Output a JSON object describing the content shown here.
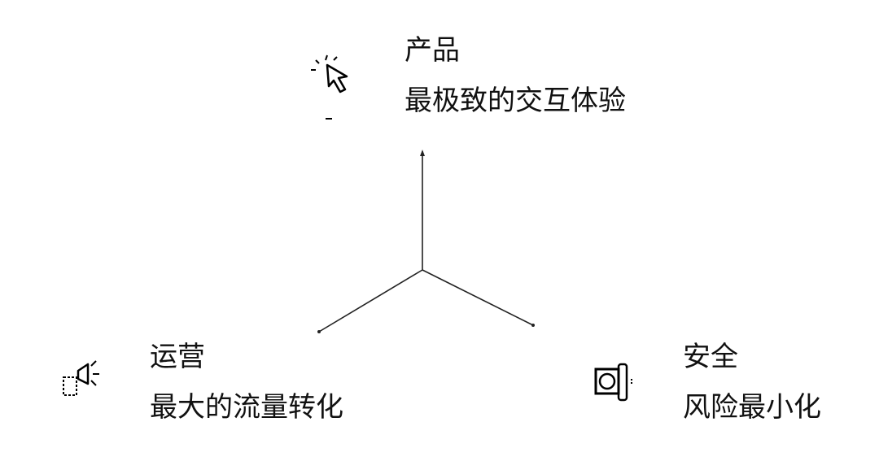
{
  "nodes": {
    "product": {
      "title": "产品",
      "desc": "最极致的交互体验",
      "icon": "cursor-click-icon"
    },
    "operation": {
      "title": "运营",
      "desc": "最大的流量转化",
      "icon": "megaphone-icon"
    },
    "security": {
      "title": "安全",
      "desc": "风险最小化",
      "icon": "shield-lock-icon"
    }
  },
  "colors": {
    "line": "#222222",
    "text": "#111111",
    "icon": "#000000"
  }
}
